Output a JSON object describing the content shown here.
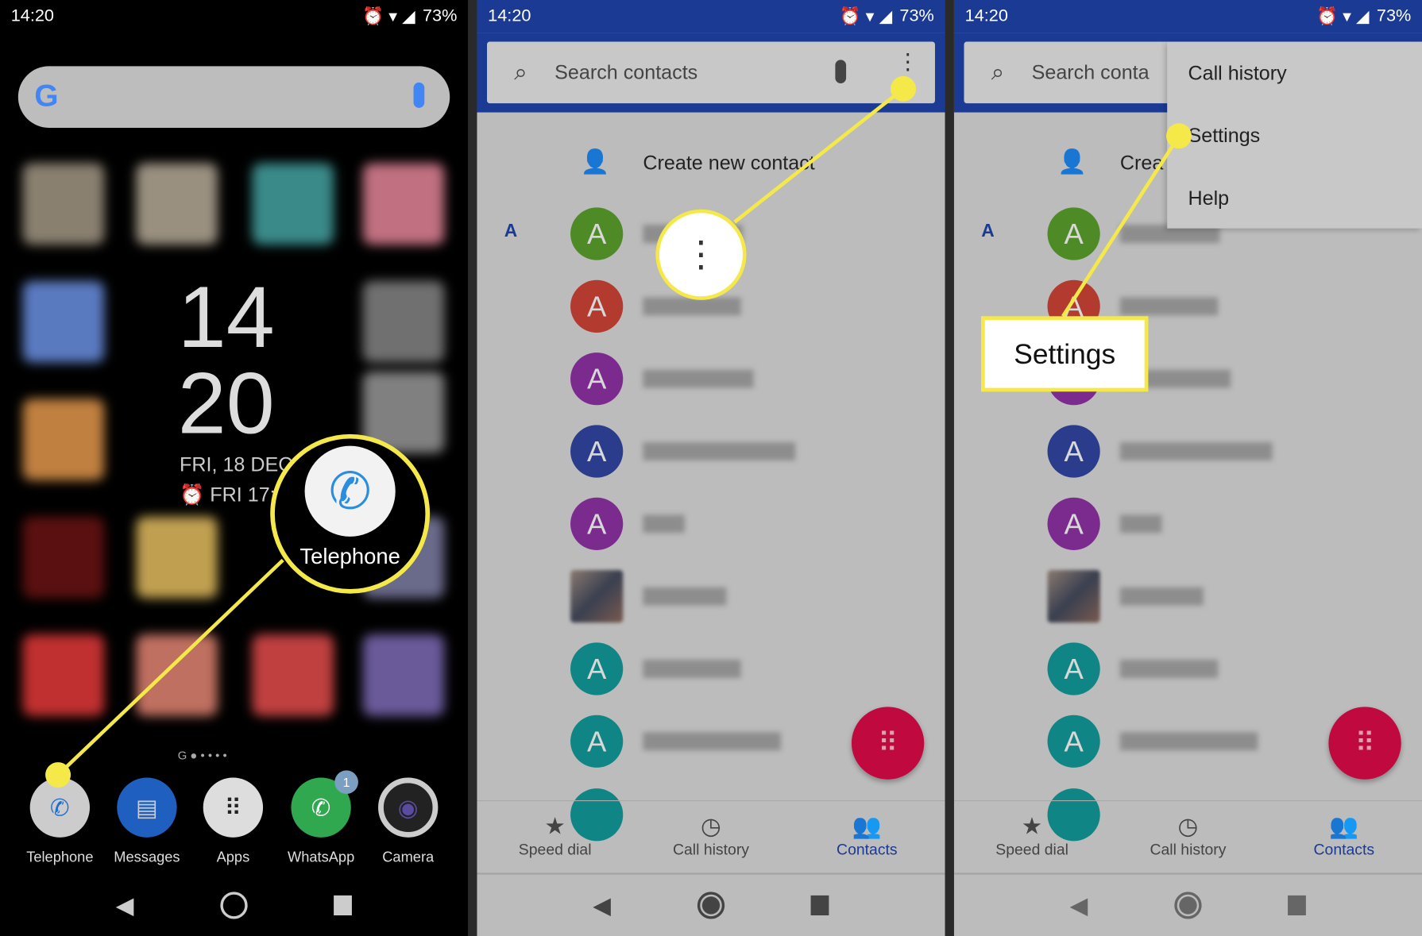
{
  "status": {
    "time": "14:20",
    "battery": "73%"
  },
  "home": {
    "clock_hour": "14",
    "clock_min": "20",
    "date": "FRI, 18 DEC",
    "alarm": "FRI 17:",
    "page_indicator": "G",
    "dock": [
      {
        "label": "Telephone",
        "icon": "phone-icon"
      },
      {
        "label": "Messages",
        "icon": "messages-icon"
      },
      {
        "label": "Apps",
        "icon": "apps-grid-icon"
      },
      {
        "label": "WhatsApp",
        "icon": "whatsapp-icon",
        "badge": "1"
      },
      {
        "label": "Camera",
        "icon": "camera-icon"
      }
    ],
    "callout_label": "Telephone"
  },
  "contacts": {
    "search_placeholder": "Search contacts",
    "search_placeholder_cut": "Search conta",
    "create_label": "Create new contact",
    "create_cut": "Crea",
    "section_letter": "A",
    "avatar_letter": "A",
    "avatar_colors": [
      "#4e8a25",
      "#b23a2e",
      "#7b2a8e",
      "#2c3c8c",
      "#7b2a8e",
      "photo",
      "#108585",
      "#108585"
    ],
    "tabs": [
      {
        "label": "Speed dial",
        "icon": "star-icon"
      },
      {
        "label": "Call history",
        "icon": "clock-icon"
      },
      {
        "label": "Contacts",
        "icon": "people-icon",
        "active": true
      }
    ]
  },
  "menu": {
    "items": [
      "Call history",
      "Settings",
      "Help"
    ]
  },
  "callout": {
    "settings": "Settings"
  },
  "colors": {
    "accent": "#1b3a94",
    "highlight": "#f5e94a",
    "fab": "#c0093f"
  }
}
